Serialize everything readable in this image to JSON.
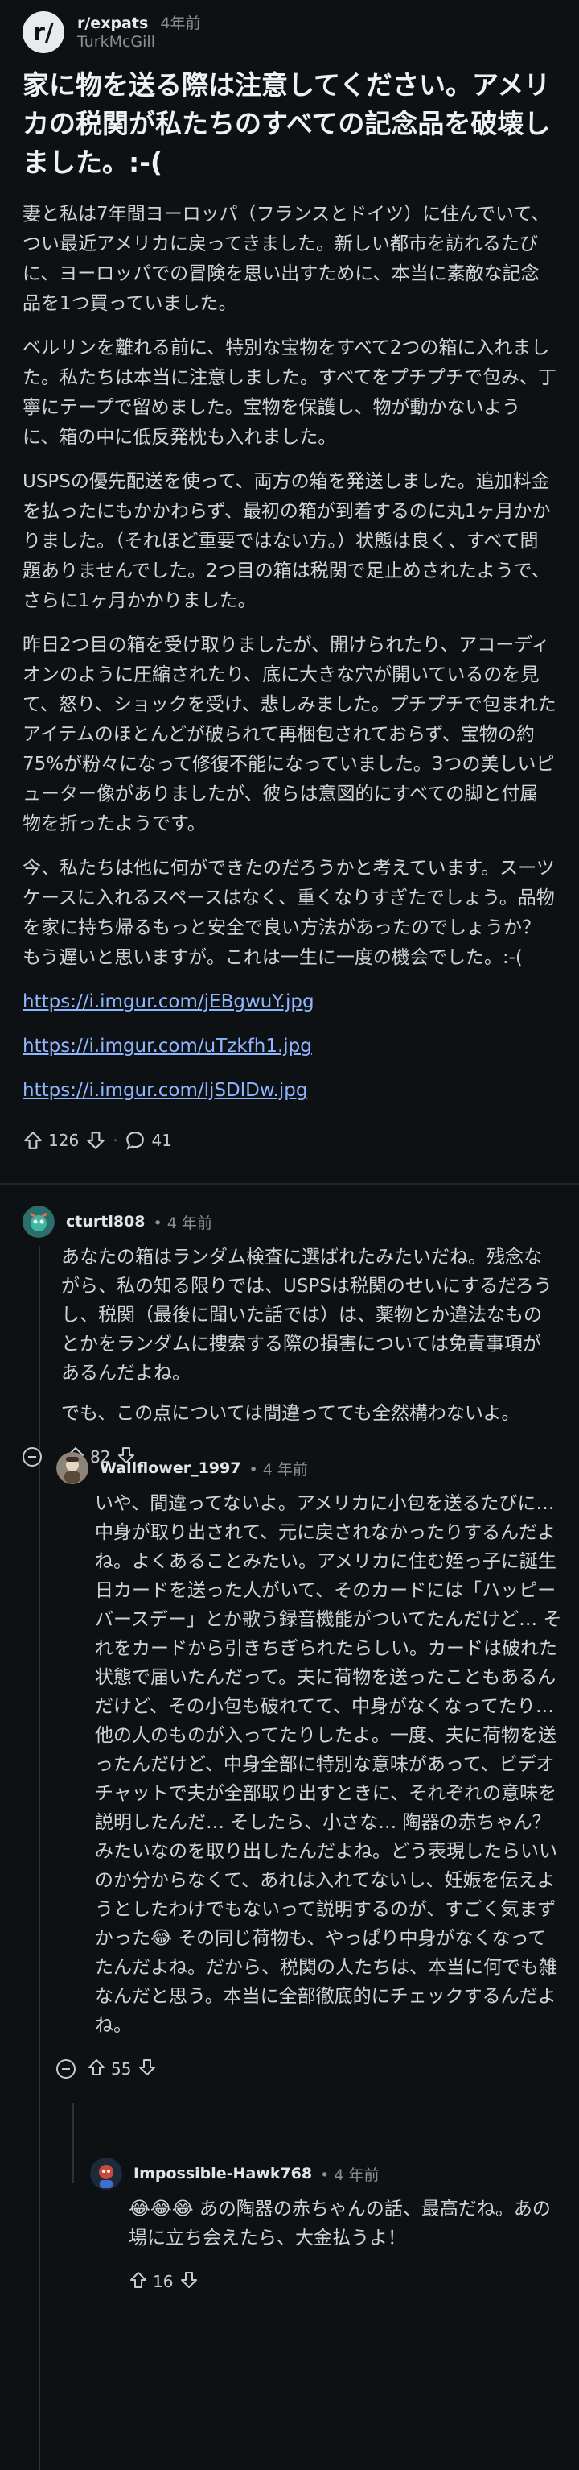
{
  "post": {
    "subreddit": "r/expats",
    "time": "4年前",
    "author": "TurkMcGill",
    "title": "家に物を送る際は注意してください。アメリカの税関が私たちのすべての記念品を破壊しました。:-(",
    "paragraphs": [
      "妻と私は7年間ヨーロッパ（フランスとドイツ）に住んでいて、つい最近アメリカに戻ってきました。新しい都市を訪れるたびに、ヨーロッパでの冒険を思い出すために、本当に素敵な記念品を1つ買っていました。",
      "ベルリンを離れる前に、特別な宝物をすべて2つの箱に入れました。私たちは本当に注意しました。すべてをプチプチで包み、丁寧にテープで留めました。宝物を保護し、物が動かないように、箱の中に低反発枕も入れました。",
      "USPSの優先配送を使って、両方の箱を発送しました。追加料金を払ったにもかかわらず、最初の箱が到着するのに丸1ヶ月かかりました。（それほど重要ではない方。）状態は良く、すべて問題ありませんでした。2つ目の箱は税関で足止めされたようで、さらに1ヶ月かかりました。",
      "昨日2つ目の箱を受け取りましたが、開けられたり、アコーディオンのように圧縮されたり、底に大きな穴が開いているのを見て、怒り、ショックを受け、悲しみました。プチプチで包まれたアイテムのほとんどが破られて再梱包されておらず、宝物の約75%が粉々になって修復不能になっていました。3つの美しいピューター像がありましたが、彼らは意図的にすべての脚と付属物を折ったようです。",
      "今、私たちは他に何ができたのだろうかと考えています。スーツケースに入れるスペースはなく、重くなりすぎたでしょう。品物を家に持ち帰るもっと安全で良い方法があったのでしょうか？もう遅いと思いますが。これは一生に一度の機会でした。:-("
    ],
    "links": [
      "https://i.imgur.com/jEBgwuY.jpg",
      "https://i.imgur.com/uTzkfh1.jpg",
      "https://i.imgur.com/ljSDlDw.jpg"
    ],
    "upvotes": "126",
    "comments": "41",
    "separator": "·"
  },
  "comments": [
    {
      "author": "cturtl808",
      "time": "4 年前",
      "dot": "•",
      "paragraphs": [
        "あなたの箱はランダム検査に選ばれたみたいだね。残念ながら、私の知る限りでは、USPSは税関のせいにするだろうし、税関（最後に聞いた話では）は、薬物とか違法なものとかをランダムに捜索する際の損害については免責事項があるんだよね。",
        "でも、この点については間違ってても全然構わないよ。"
      ],
      "votes": "82"
    },
    {
      "author": "Wallflower_1997",
      "time": "4 年前",
      "dot": "•",
      "paragraphs": [
        "いや、間違ってないよ。アメリカに小包を送るたびに… 中身が取り出されて、元に戻されなかったりするんだよね。よくあることみたい。アメリカに住む姪っ子に誕生日カードを送った人がいて、そのカードには「ハッピーバースデー」とか歌う録音機能がついてたんだけど… それをカードから引きちぎられたらしい。カードは破れた状態で届いたんだって。夫に荷物を送ったこともあるんだけど、その小包も破れてて、中身がなくなってたり… 他の人のものが入ってたりしたよ。一度、夫に荷物を送ったんだけど、中身全部に特別な意味があって、ビデオチャットで夫が全部取り出すときに、それぞれの意味を説明したんだ… そしたら、小さな… 陶器の赤ちゃん？みたいなのを取り出したんだよね。どう表現したらいいのか分からなくて、あれは入れてないし、妊娠を伝えようとしたわけでもないって説明するのが、すごく気まずかった😂 その同じ荷物も、やっぱり中身がなくなってたんだよね。だから、税関の人たちは、本当に何でも雑なんだと思う。本当に全部徹底的にチェックするんだよね。"
      ],
      "votes": "55"
    },
    {
      "author": "Impossible-Hawk768",
      "time": "4 年前",
      "dot": "•",
      "paragraphs": [
        "😂😂😂 あの陶器の赤ちゃんの話、最高だね。あの場に立ち会えたら、大金払うよ！"
      ],
      "votes": "16"
    }
  ],
  "colors": {
    "background": "#0d1114",
    "link": "#8fb6ff",
    "thread_line": "#2c3236"
  }
}
